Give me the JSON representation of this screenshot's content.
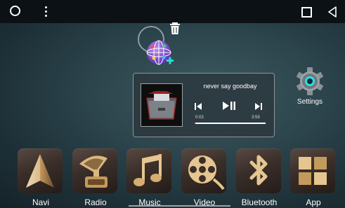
{
  "status_bar": {
    "icons": [
      "circle-icon",
      "overflow-menu-icon",
      "recents-icon",
      "back-icon"
    ]
  },
  "music_widget": {
    "song_title": "never say goodbay",
    "current_time": "0:03",
    "total_time": "3:59",
    "progress_percent": 2,
    "accent_color": "#cc2222"
  },
  "settings": {
    "label": "Settings"
  },
  "dock": {
    "items": [
      {
        "label": "Navi",
        "icon": "navi-arrow-icon"
      },
      {
        "label": "Radio",
        "icon": "radio-gramophone-icon"
      },
      {
        "label": "Music",
        "icon": "music-note-icon"
      },
      {
        "label": "Video",
        "icon": "video-reel-icon"
      },
      {
        "label": "Bluetooth",
        "icon": "bluetooth-icon"
      },
      {
        "label": "App",
        "icon": "app-grid-icon"
      }
    ]
  }
}
